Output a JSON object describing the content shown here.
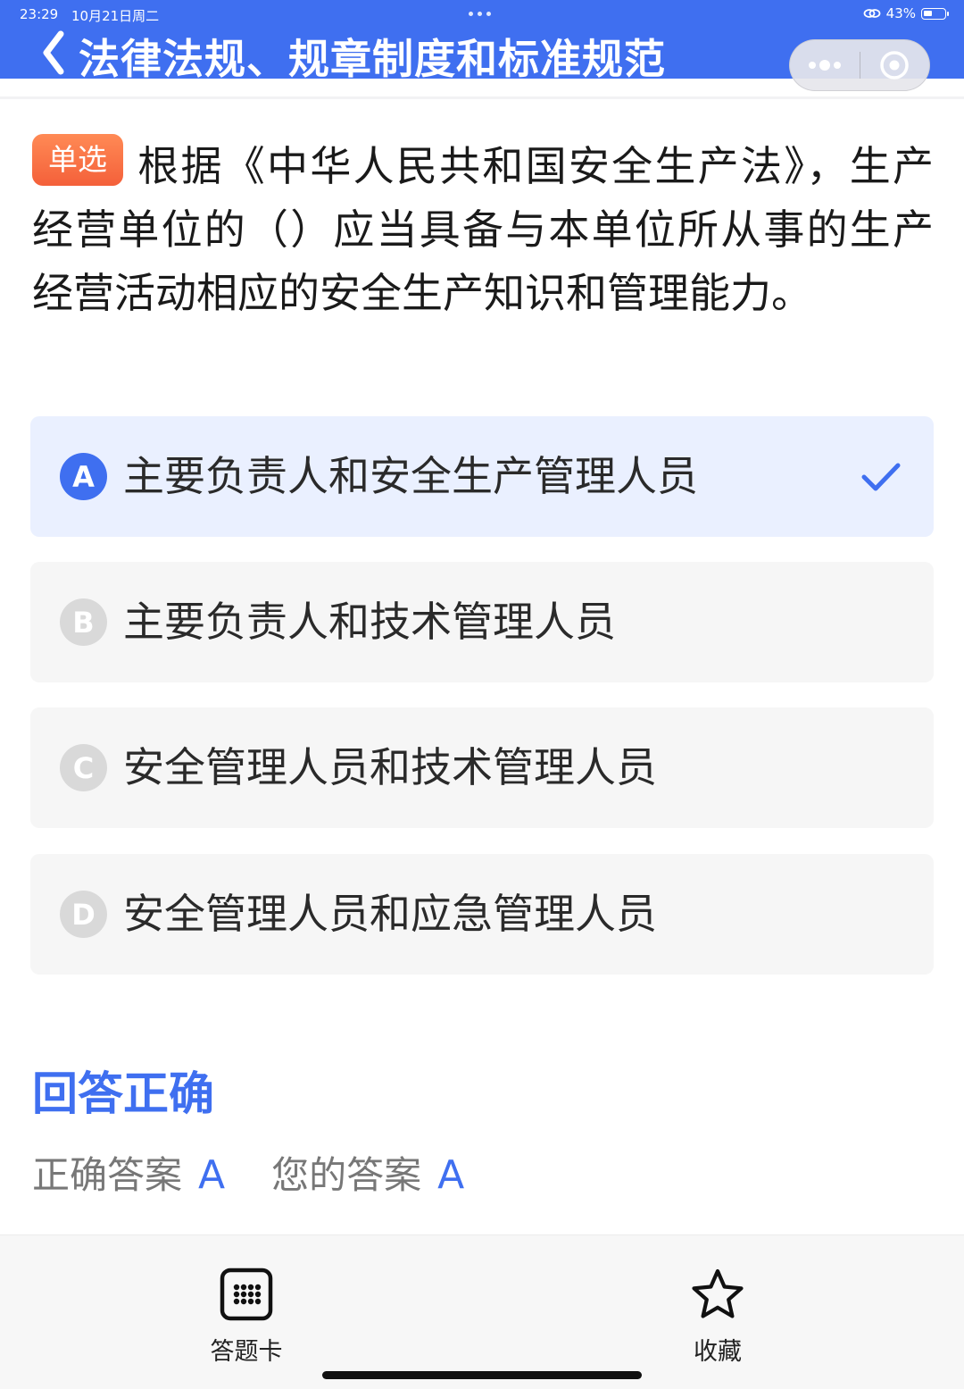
{
  "status_bar": {
    "time": "23:29",
    "date": "10月21日周二",
    "battery": "43%"
  },
  "header": {
    "title": "法律法规、规章制度和标准规范"
  },
  "question": {
    "type_badge": "单选",
    "text": "根据《中华人民共和国安全生产法》，生产经营单位的（）应当具备与本单位所从事的生产经营活动相应的安全生产知识和管理能力。"
  },
  "options": [
    {
      "letter": "A",
      "text": "主要负责人和安全生产管理人员",
      "selected": true
    },
    {
      "letter": "B",
      "text": "主要负责人和技术管理人员",
      "selected": false
    },
    {
      "letter": "C",
      "text": "安全管理人员和技术管理人员",
      "selected": false
    },
    {
      "letter": "D",
      "text": "安全管理人员和应急管理人员",
      "selected": false
    }
  ],
  "result": {
    "title": "回答正确",
    "correct_label": "正确答案",
    "correct_value": "A",
    "your_label": "您的答案",
    "your_value": "A"
  },
  "bottom_bar": {
    "answer_card_label": "答题卡",
    "favorite_label": "收藏"
  },
  "colors": {
    "primary": "#3f6ff0",
    "badge": "#f4603a",
    "option_bg": "#f6f6f6",
    "option_selected_bg": "#eaf0ff"
  }
}
